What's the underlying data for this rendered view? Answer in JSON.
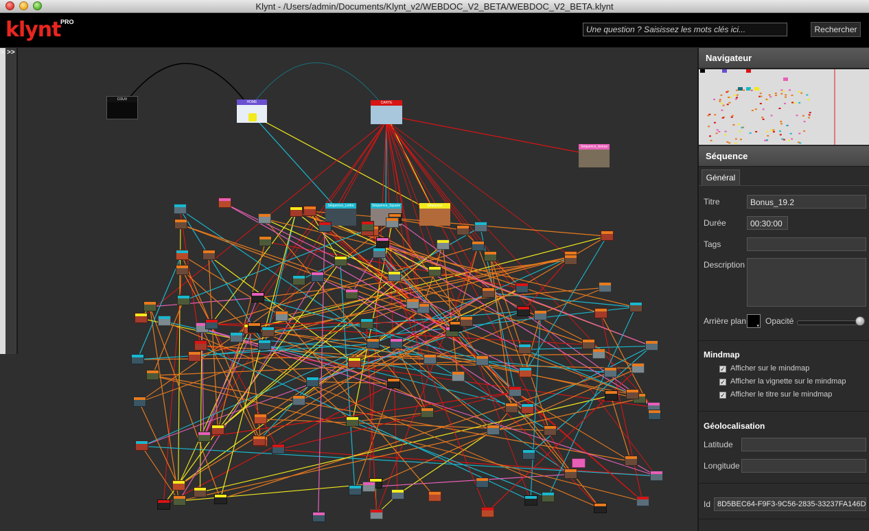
{
  "window": {
    "title": "Klynt - /Users/admin/Documents/Klynt_v2/WEBDOC_V2_BETA/WEBDOC_V2_BETA.klynt"
  },
  "header": {
    "logo": "klynt",
    "logo_badge": "PRO",
    "search_placeholder": "Une question ? Saisissez les mots clés ici...",
    "search_button": "Rechercher"
  },
  "canvas": {
    "toggle_left": ">",
    "toggle_right": ">>",
    "nodes": {
      "couv": "COUV",
      "home": "HOME",
      "carte": "CARTE",
      "bonus": "Séquence_bonus",
      "seq1": "Séquence_Lettre",
      "seq2": "Séquence_Square",
      "seq3": "Séquence"
    }
  },
  "navigator": {
    "title": "Navigateur"
  },
  "sequence": {
    "title": "Séquence",
    "tab_general": "Général",
    "titre_label": "Titre",
    "titre_value": "Bonus_19.2",
    "duree_label": "Durée",
    "duree_value": "00:30:00",
    "tags_label": "Tags",
    "tags_value": "",
    "description_label": "Description",
    "description_value": "",
    "arriere_label": "Arrière plan",
    "opacite_label": "Opacité",
    "opacity": 1.0,
    "mindmap_title": "Mindmap",
    "mindmap_opt1": "Afficher sur le mindmap",
    "mindmap_opt2": "Afficher la vignette sur le mindmap",
    "mindmap_opt3": "Afficher le titre sur le mindmap",
    "geo_title": "Géolocalisation",
    "latitude_label": "Latitude",
    "latitude_value": "",
    "longitude_label": "Longitude",
    "longitude_value": "",
    "id_label": "Id",
    "id_value": "8D5BEC64-F9F3-9C56-2835-33237FA146D"
  },
  "colors": {
    "accent": "#e8261f",
    "cyan": "#19b8cf",
    "yellow": "#f2ea1c",
    "orange": "#e87a1e",
    "pink": "#e85fb8",
    "red": "#d81414"
  }
}
